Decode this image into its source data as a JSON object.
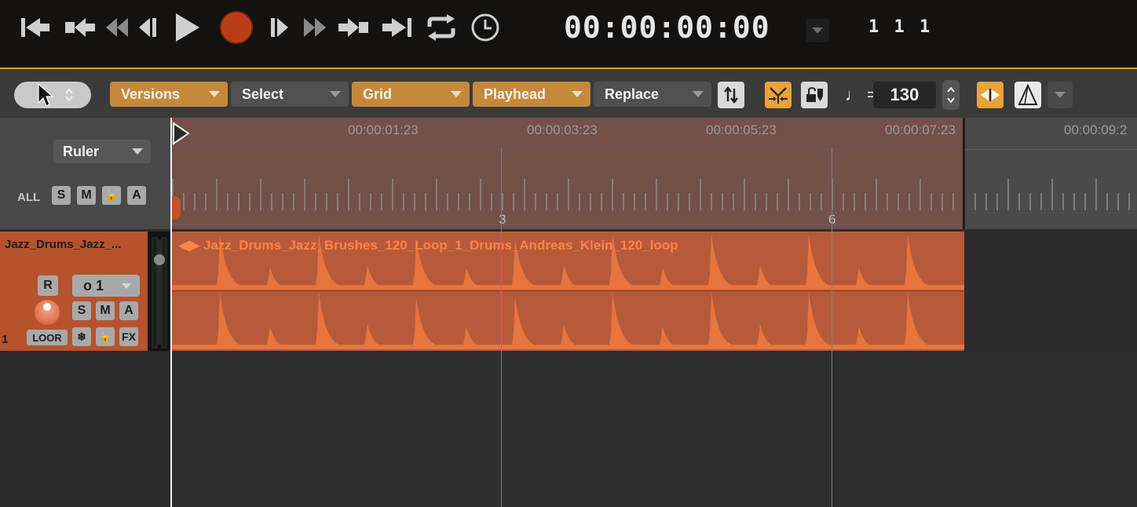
{
  "transport": {
    "buttons": [
      {
        "icon": "go-to-start-icon"
      },
      {
        "icon": "previous-marker-icon"
      },
      {
        "icon": "rewind-icon"
      },
      {
        "icon": "step-back-icon"
      },
      {
        "icon": "play-icon"
      },
      {
        "icon": "record-icon"
      },
      {
        "icon": "step-forward-icon"
      },
      {
        "icon": "fast-forward-icon"
      },
      {
        "icon": "next-marker-icon"
      },
      {
        "icon": "go-to-end-icon"
      },
      {
        "icon": "loop-icon"
      },
      {
        "icon": "clock-icon"
      }
    ],
    "timecode": "00:00:00:00",
    "bar_position": "1 1 1"
  },
  "toolbar": {
    "tool_selector_icon": "pointer-icon",
    "dropdowns": [
      {
        "label": "Versions",
        "style": "orange"
      },
      {
        "label": "Select",
        "style": "gray"
      },
      {
        "label": "Grid",
        "style": "orange"
      },
      {
        "label": "Playhead",
        "style": "orange"
      },
      {
        "label": "Replace",
        "style": "gray"
      }
    ],
    "tempo_label": "♩ =",
    "tempo_value": "130"
  },
  "ruler": {
    "mode_label": "Ruler",
    "all_label": "ALL",
    "all_buttons": [
      "S",
      "M",
      "🔓",
      "A"
    ],
    "time_labels": [
      "00:00:01:23",
      "00:00:03:23",
      "00:00:05:23",
      "00:00:07:23",
      "00:00:09:2"
    ],
    "bar_labels": [
      "3",
      "6"
    ]
  },
  "track": {
    "name": "Jazz_Drums_Jazz_...",
    "number": "1",
    "record_label": "R",
    "output_label": "o 1",
    "buttons_row1": [
      "S",
      "M",
      "A"
    ],
    "buttons_row2": [
      "LOOR",
      "❄",
      "🔓",
      "FX"
    ]
  },
  "region": {
    "title": "◀▶ Jazz_Drums_Jazz_Brushes_120_Loop_1_Drums_Andreas_Klein_120_loop"
  },
  "colors": {
    "accent": "#c48a3a",
    "track": "#b6532d",
    "region": "#b65a3a",
    "waveform": "#e8743e",
    "record": "#c2421a"
  }
}
